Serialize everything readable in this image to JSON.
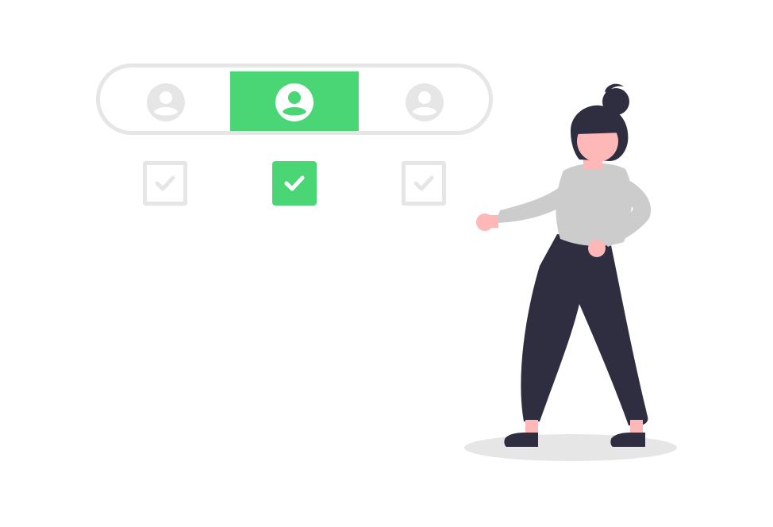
{
  "colors": {
    "accent": "#4ad675",
    "inactive": "#e6e6e6",
    "hair_pants": "#2f2e41",
    "skin": "#ffb8b8",
    "shirt": "#cccccc",
    "shadow": "#e6e6e6"
  },
  "profile_selector": {
    "selected_index": 1,
    "options": [
      {
        "icon": "user-avatar-icon",
        "selected": false
      },
      {
        "icon": "user-avatar-icon",
        "selected": true
      },
      {
        "icon": "user-avatar-icon",
        "selected": false
      }
    ]
  },
  "checkboxes": [
    {
      "checked": false,
      "icon": "check-icon"
    },
    {
      "checked": true,
      "icon": "check-icon"
    },
    {
      "checked": false,
      "icon": "check-icon"
    }
  ],
  "illustration": {
    "subject": "person-pointing",
    "has_floor_shadow": true
  }
}
